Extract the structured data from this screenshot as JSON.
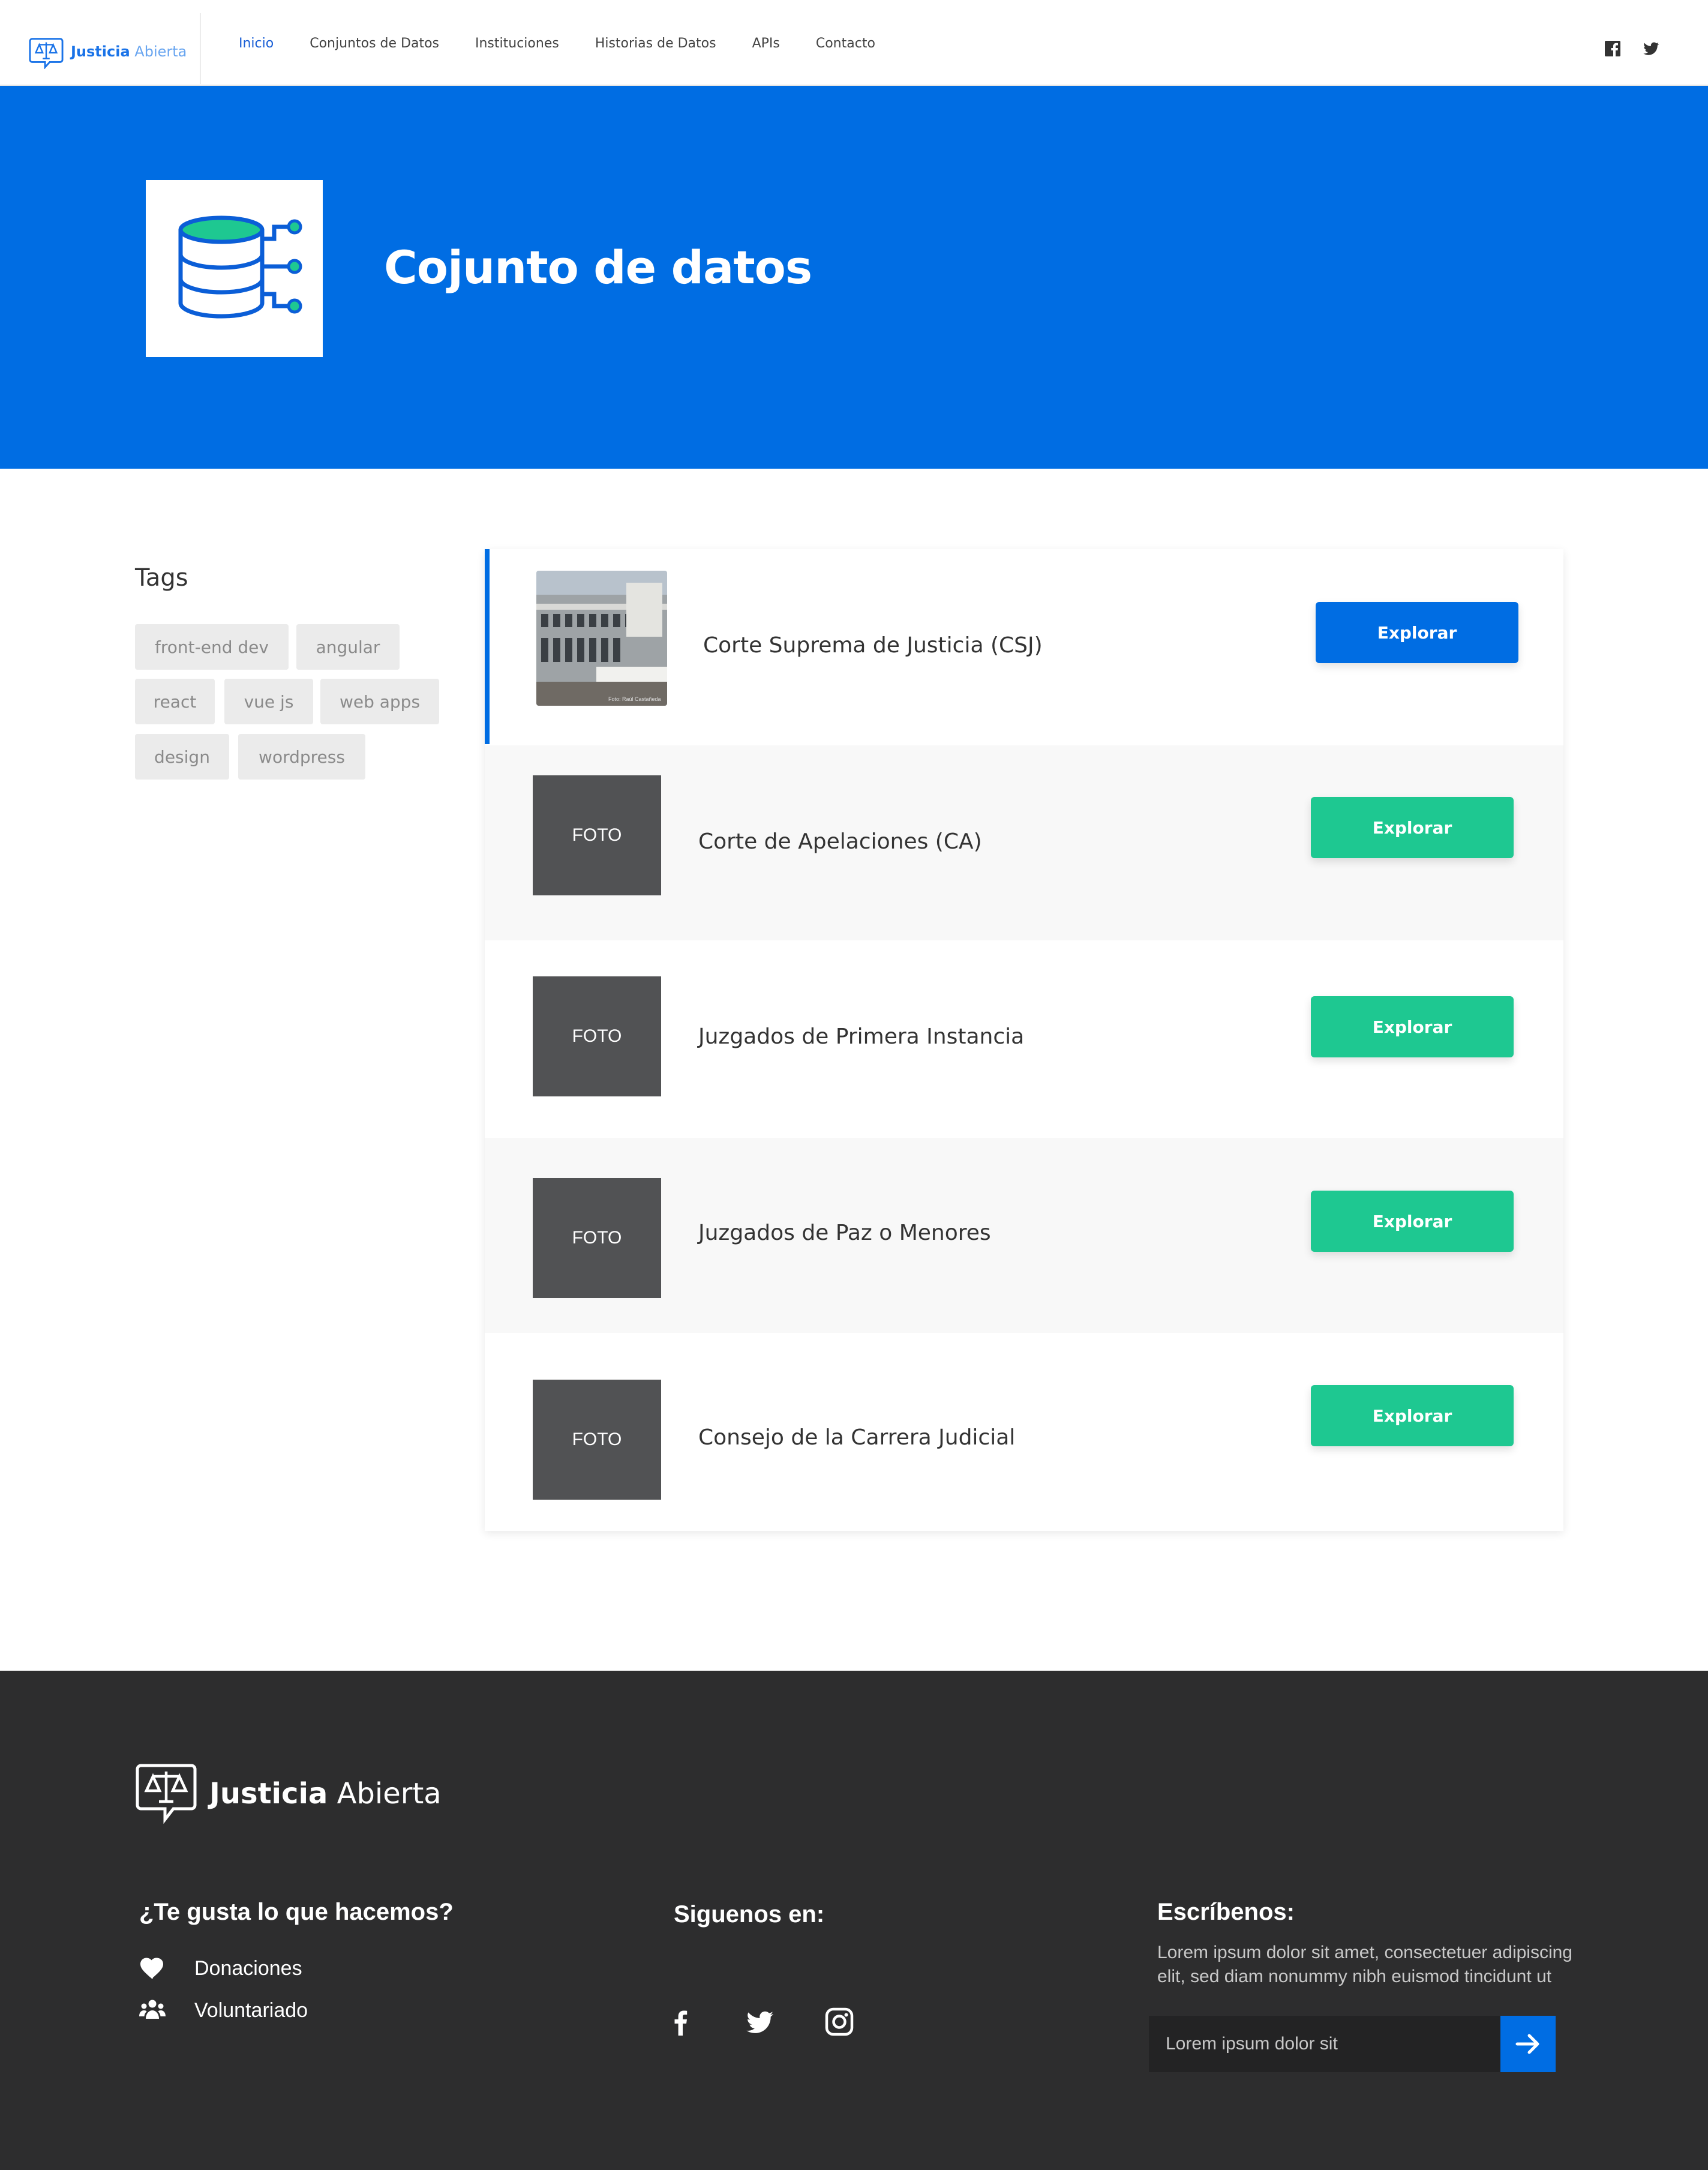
{
  "header": {
    "logo": {
      "bold": "Justicia",
      "light": "Abierta"
    },
    "nav": [
      "Inicio",
      "Conjuntos de Datos",
      "Instituciones",
      "Historias de Datos",
      "APIs",
      "Contacto"
    ],
    "active_nav": "Inicio",
    "social_icons": [
      "facebook-icon",
      "twitter-icon"
    ]
  },
  "hero": {
    "icon": "database-icon",
    "title": "Cojunto de datos"
  },
  "sidebar": {
    "title": "Tags",
    "tags": [
      "front-end dev",
      "angular",
      "react",
      "vue js",
      "web apps",
      "design",
      "wordpress"
    ]
  },
  "datasets": [
    {
      "title": "Corte Suprema de Justicia (CSJ)",
      "thumb": "photo",
      "photo_caption": "Foto: Raúl Castañeda",
      "button": "Explorar",
      "button_color": "#006de3",
      "active": true
    },
    {
      "title": "Corte de Apelaciones (CA)",
      "thumb": "FOTO",
      "button": "Explorar",
      "button_color": "#1ec891"
    },
    {
      "title": "Juzgados de Primera Instancia",
      "thumb": "FOTO",
      "button": "Explorar",
      "button_color": "#1ec891"
    },
    {
      "title": "Juzgados de Paz o Menores",
      "thumb": "FOTO",
      "button": "Explorar",
      "button_color": "#1ec891"
    },
    {
      "title": "Consejo de la Carrera Judicial",
      "thumb": "FOTO",
      "button": "Explorar",
      "button_color": "#1ec891"
    }
  ],
  "footer": {
    "logo": {
      "bold": "Justicia",
      "light": "Abierta"
    },
    "support": {
      "title": "¿Te gusta lo que hacemos?",
      "items": [
        {
          "icon": "heart-icon",
          "label": "Donaciones"
        },
        {
          "icon": "people-icon",
          "label": "Voluntariado"
        }
      ]
    },
    "follow": {
      "title": "Siguenos en:",
      "icons": [
        "facebook-icon",
        "twitter-icon",
        "instagram-icon"
      ]
    },
    "contact": {
      "title": "Escríbenos:",
      "text": "Lorem ipsum dolor sit amet, consectetuer adipiscing elit, sed diam nonummy nibh euismod tincidunt ut",
      "placeholder": "Lorem ipsum dolor sit",
      "submit_icon": "arrow-right-icon"
    }
  },
  "colors": {
    "primary": "#006de3",
    "accent": "#1ec891",
    "footer_bg": "#2d2d2e"
  }
}
